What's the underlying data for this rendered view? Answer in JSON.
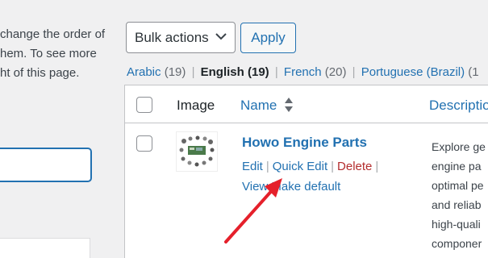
{
  "help_text": "change the order of\nhem. To see more\nht of this page.",
  "bulk": {
    "label": "Bulk actions",
    "apply_label": "Apply"
  },
  "languages": [
    {
      "name": "Arabic",
      "count": "(19)"
    },
    {
      "name": "English",
      "count": "(19)"
    },
    {
      "name": "French",
      "count": "(20)"
    },
    {
      "name": "Portuguese (Brazil)",
      "count": "(1"
    }
  ],
  "table": {
    "col_image": "Image",
    "col_name": "Name",
    "col_desc": "Descriptio",
    "row": {
      "title": "Howo Engine Parts",
      "action_edit": "Edit",
      "action_quick_edit": "Quick Edit",
      "action_delete": "Delete",
      "action_view": "View",
      "action_make_default": "Make default",
      "description": "Explore ge\nengine pa\noptimal pe\nand reliab\nhigh-quali\ncomponer"
    }
  },
  "colors": {
    "link": "#2271b1",
    "delete": "#b32d2e",
    "annotation": "#e5202b"
  }
}
